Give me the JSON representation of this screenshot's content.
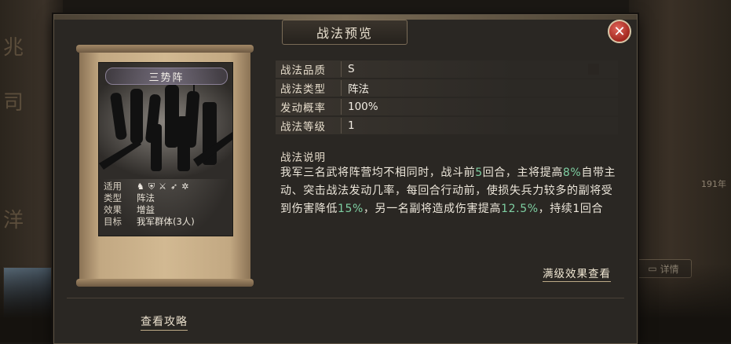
{
  "background": {
    "left_glyphs": [
      "兆",
      "司",
      "洋"
    ],
    "right_badge": "191年",
    "right_detail_label": "详情"
  },
  "dialog": {
    "title": "战法预览",
    "close_icon": "close-icon"
  },
  "card": {
    "name": "三势阵",
    "rows": [
      {
        "key": "适用",
        "icons": [
          "cavalry-icon",
          "shield-icon",
          "crossed-swords-icon",
          "arrow-icon",
          "wheel-icon"
        ]
      },
      {
        "key": "类型",
        "value": "阵法"
      },
      {
        "key": "效果",
        "value": "增益"
      },
      {
        "key": "目标",
        "value": "我军群体(3人)"
      }
    ]
  },
  "properties": [
    {
      "key": "战法品质",
      "value": "S"
    },
    {
      "key": "战法类型",
      "value": "阵法"
    },
    {
      "key": "发动概率",
      "value": "100%"
    },
    {
      "key": "战法等级",
      "value": "1"
    }
  ],
  "description": {
    "label": "战法说明",
    "segments": [
      {
        "text": "我军三名武将阵营均不相同时，战斗前",
        "hl": false
      },
      {
        "text": "5",
        "hl": true
      },
      {
        "text": "回合，主将提高",
        "hl": false
      },
      {
        "text": "8%",
        "hl": true
      },
      {
        "text": "自带主动、突击战法发动几率，每回合行动前，使损失兵力较多的副将受到伤害降低",
        "hl": false
      },
      {
        "text": "15%",
        "hl": true
      },
      {
        "text": "，另一名副将造成伤害提高",
        "hl": false
      },
      {
        "text": "12.5%",
        "hl": true
      },
      {
        "text": "，持续1回合",
        "hl": false
      }
    ]
  },
  "links": {
    "max_level": "满级效果查看",
    "strategy": "查看攻略"
  }
}
